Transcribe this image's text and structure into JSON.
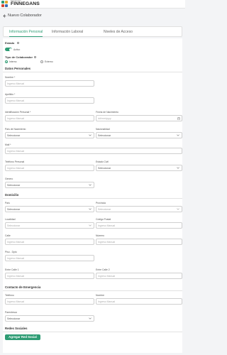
{
  "header": {
    "logo_small": "Soluciones",
    "logo_big": "FINNEGANS",
    "back_label": "Nuevo Colaborador"
  },
  "tabs": [
    {
      "label": "Información Personal",
      "active": true
    },
    {
      "label": "Información Laboral",
      "active": false
    },
    {
      "label": "Niveles de Acceso",
      "active": false
    }
  ],
  "estado": {
    "label": "Estado",
    "toggle_label": "Activo",
    "active": true
  },
  "tipo": {
    "label": "Tipo de Colaborador",
    "options": [
      "Interno",
      "Externo"
    ],
    "selected": "Interno"
  },
  "sections": {
    "personales": "Datos Personales",
    "domicilio": "Domicilio",
    "emergencia": "Contacto de Emergencia",
    "redes": "Redes Sociales"
  },
  "fields": {
    "nombre": {
      "label": "Nombre *",
      "placeholder": "Ingreso Manual"
    },
    "apellido": {
      "label": "Apellido *",
      "placeholder": "Ingreso Manual"
    },
    "identificacion": {
      "label": "Identificación Personal *",
      "placeholder": "Ingreso Manual"
    },
    "fecha_nac": {
      "label": "Fecha de Nacimiento",
      "placeholder": "dd/mm/yyyy"
    },
    "pais_nac": {
      "label": "País de Nacimiento",
      "value": "Seleccionar"
    },
    "nacionalidad": {
      "label": "Nacionalidad",
      "value": "Seleccionar"
    },
    "mail": {
      "label": "Mail *",
      "placeholder": "Ingreso Manual"
    },
    "telefono_personal": {
      "label": "Teléfono Personal",
      "placeholder": "Ingreso Manual"
    },
    "estado_civil": {
      "label": "Estado Civil",
      "value": "Seleccionar"
    },
    "genero": {
      "label": "Genero",
      "value": "Seleccionar"
    },
    "pais": {
      "label": "País",
      "value": "Seleccionar"
    },
    "provincia": {
      "label": "Provincia",
      "value": "Seleccionar"
    },
    "localidad": {
      "label": "Localidad",
      "value": "Seleccionar"
    },
    "codigo_postal": {
      "label": "Código Postal",
      "placeholder": "Ingreso Manual"
    },
    "calle": {
      "label": "Calle",
      "placeholder": "Ingreso Manual"
    },
    "numero": {
      "label": "Número",
      "placeholder": "Ingreso Manual"
    },
    "piso_dpto": {
      "label": "Piso - Dpto",
      "placeholder": "Ingreso Manual"
    },
    "entre_calle_1": {
      "label": "Entre Calle 1",
      "placeholder": "Ingreso Manual"
    },
    "entre_calle_2": {
      "label": "Entre Calle 2",
      "placeholder": "Ingreso Manual"
    },
    "em_telefono": {
      "label": "Teléfono",
      "placeholder": "Ingreso Manual"
    },
    "em_nombre": {
      "label": "Nombre",
      "placeholder": "Ingreso Manual"
    },
    "parentesco": {
      "label": "Parentesco",
      "value": "Seleccionar"
    }
  },
  "buttons": {
    "add_social": "Agregar Red Social"
  },
  "colors": {
    "accent": "#2e9c74"
  }
}
